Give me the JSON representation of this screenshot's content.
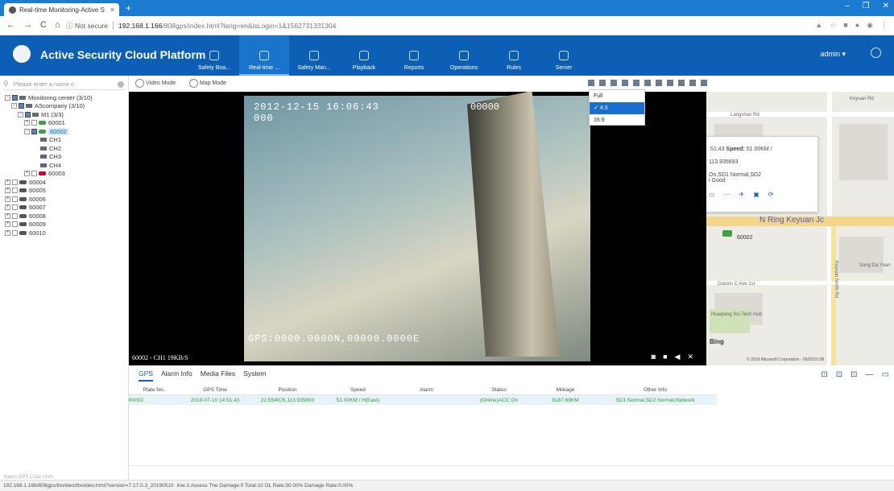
{
  "browser": {
    "tab_title": "Real-time Monitoring-Active S",
    "not_secure": "Not secure",
    "url_host": "192.168.1.166",
    "url_path": "/808gps/index.html?lang=en&isLogin=1&1562731331304"
  },
  "header": {
    "app_title": "Active Security Cloud Platform",
    "nav": [
      "Safety Boa...",
      "Real-time ...",
      "Safety Man...",
      "Playback",
      "Reports",
      "Operations",
      "Rules",
      "Server"
    ],
    "active_nav": "Real-time ...",
    "user": "admin",
    "accent": "#0d5fb5"
  },
  "sidebar": {
    "search_placeholder": "Please enter a name o",
    "tree": {
      "center": "Monitoring center (3/10)",
      "company": "AScompany (3/10)",
      "group": "M1 (3/3)",
      "vehicles": [
        "60001",
        "60002",
        "60003",
        "60004",
        "60005",
        "60006",
        "60007",
        "60008",
        "60009",
        "60010"
      ],
      "channels": [
        "CH1",
        "CH2",
        "CH3",
        "CH4"
      ]
    }
  },
  "toolbar": {
    "video_mode": "Video Mode",
    "map_mode": "Map Mode"
  },
  "ratio_menu": [
    "Full",
    "4:3",
    "16:9"
  ],
  "ratio_selected": "4:3",
  "video": {
    "timestamp": "2012-12-15 16:06:43",
    "timestamp_line2": "000",
    "counter": "00000",
    "gps_overlay": "GPS:0000.0000N,00000.0000E",
    "channel_label": "60002 - CH1 19KB/S"
  },
  "map": {
    "popup_time": ":51:43",
    "popup_speed_label": "Speed:",
    "popup_speed": "51.00KM /",
    "popup_pos": "113.935693",
    "popup_status": "On,SD1 Normal,SD2",
    "popup_signal": "l Good",
    "road_name": "N Ring Keyuan Jc",
    "vehicle": "60002",
    "labels": [
      "Langshan Rd",
      "Keyuan North Rd",
      "Sang Da Yuan",
      "Gaoxin C Ave 1st",
      "Keyuan Rd",
      "Huaqiang Sci-Tech Hub"
    ],
    "bing": "Bing",
    "copyright": "© 2019 Microsoft Corporation - 05/2018 DB"
  },
  "bottom": {
    "tabs": [
      "GPS",
      "Alarm Info",
      "Media Files",
      "System"
    ],
    "active_tab": "GPS",
    "columns": [
      "Plate No.",
      "GPS Time",
      "Position",
      "Speed",
      "Alarm",
      "Status",
      "Mileage",
      "Other Info"
    ],
    "rows": [
      [
        "60002",
        "2019-07-10 14:51:43",
        "22.554976,113.935693",
        "51.00KM / H(East)",
        "",
        "(Online)ACC On",
        "8167.69KM",
        "SD1 Normal,SD2 Normal,Network"
      ]
    ]
  },
  "statusbar": {
    "url": "192.168.1.166/808gps/ttxvideo/ttxvideo.html?version=7.17.0.3_20190510",
    "stats": "line:3   Assess The Damage:0   Total:10   OL Rate:30.00%   Damage Rate:0.00%",
    "ghost": "Status   GPS   Color   Units"
  }
}
